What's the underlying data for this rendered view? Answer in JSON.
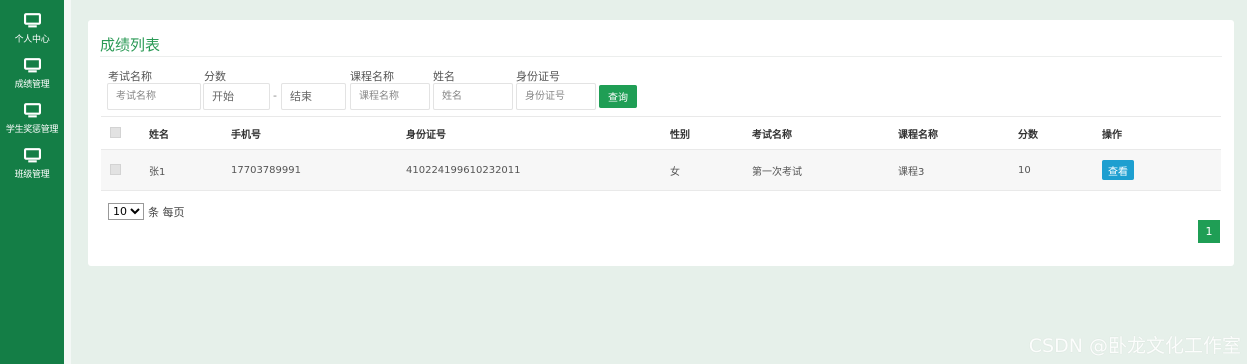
{
  "sidebar": {
    "items": [
      {
        "label": "个人中心",
        "icon": "monitor-icon"
      },
      {
        "label": "成绩管理",
        "icon": "monitor-icon"
      },
      {
        "label": "学生奖惩管理",
        "icon": "monitor-icon"
      },
      {
        "label": "班级管理",
        "icon": "monitor-icon"
      }
    ]
  },
  "card": {
    "title": "成绩列表"
  },
  "filters": {
    "exam_name": {
      "label": "考试名称",
      "placeholder": "考试名称"
    },
    "score": {
      "label": "分数",
      "start_placeholder": "开始",
      "separator": "-",
      "end_placeholder": "结束"
    },
    "course_name": {
      "label": "课程名称",
      "placeholder": "课程名称"
    },
    "name": {
      "label": "姓名",
      "placeholder": "姓名"
    },
    "id_number": {
      "label": "身份证号",
      "placeholder": "身份证号"
    },
    "search_label": "查询"
  },
  "table": {
    "headers": [
      "姓名",
      "手机号",
      "身份证号",
      "性别",
      "考试名称",
      "课程名称",
      "分数",
      "操作"
    ],
    "rows": [
      {
        "name": "张1",
        "phone": "17703789991",
        "id_number": "410224199610232011",
        "gender": "女",
        "exam_name": "第一次考试",
        "course_name": "课程3",
        "score": "10",
        "action_label": "查看"
      }
    ]
  },
  "pagination": {
    "page_size": "10",
    "page_size_suffix": "条 每页",
    "current_page": "1"
  },
  "watermark": "CSDN @卧龙文化工作室",
  "colors": {
    "sidebar_bg": "#147e46",
    "accent_green": "#1f9e55",
    "view_button": "#1e9fd0",
    "page_bg": "#e6f0ea"
  }
}
